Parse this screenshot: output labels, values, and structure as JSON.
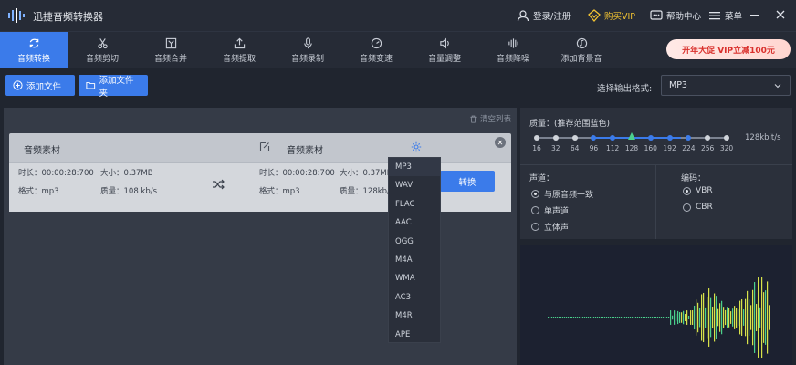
{
  "app": {
    "title": "迅捷音频转换器"
  },
  "titlebar": {
    "login": "登录/注册",
    "vip": "购买VIP",
    "help": "帮助中心",
    "menu": "菜单"
  },
  "tabs": [
    {
      "label": "音频转换",
      "icon": "refresh-icon",
      "active": true
    },
    {
      "label": "音频剪切",
      "icon": "scissors-icon"
    },
    {
      "label": "音频合并",
      "icon": "merge-icon"
    },
    {
      "label": "音频提取",
      "icon": "extract-icon"
    },
    {
      "label": "音频录制",
      "icon": "microphone-icon"
    },
    {
      "label": "音频变速",
      "icon": "speed-icon"
    },
    {
      "label": "音量调整",
      "icon": "volume-icon"
    },
    {
      "label": "音频降噪",
      "icon": "waveform-icon"
    },
    {
      "label": "添加背景音",
      "icon": "music-note-icon"
    }
  ],
  "vip_banner": "开年大促 VIP立减100元",
  "actions": {
    "add_file": "添加文件",
    "add_folder": "添加文件夹",
    "format_label": "选择输出格式:",
    "format_value": "MP3"
  },
  "list": {
    "clear": "清空列表",
    "card": {
      "src_name": "音频素材",
      "dst_name": "音频素材",
      "src": {
        "duration": "时长：00:00:28:700",
        "size": "大小：0.37MB",
        "format": "格式：mp3",
        "quality": "质量：108 kb/s"
      },
      "dst": {
        "duration": "时长：00:00:28:700",
        "size": "大小：0.37MB",
        "format": "格式：mp3",
        "quality": "质量：128kb/s"
      },
      "convert": "转换"
    }
  },
  "dropdown": [
    "MP3",
    "WAV",
    "FLAC",
    "AAC",
    "OGG",
    "M4A",
    "WMA",
    "AC3",
    "M4R",
    "APE"
  ],
  "quality": {
    "label": "质量：(推荐范围蓝色)",
    "ticks": [
      "16",
      "32",
      "64",
      "96",
      "112",
      "128",
      "160",
      "192",
      "224",
      "256",
      "320"
    ],
    "selected": "128",
    "value_text": "128kbit/s"
  },
  "channel": {
    "title": "声道：",
    "options": [
      "与原音频一致",
      "单声道",
      "立体声"
    ],
    "selected": 0
  },
  "encoding": {
    "title": "编码：",
    "options": [
      "VBR",
      "CBR"
    ],
    "selected": 0
  },
  "colors": {
    "accent": "#3b7bea",
    "vip": "#f1c232",
    "wave_green": "#4bd08d",
    "wave_yellow": "#d8e24a"
  }
}
